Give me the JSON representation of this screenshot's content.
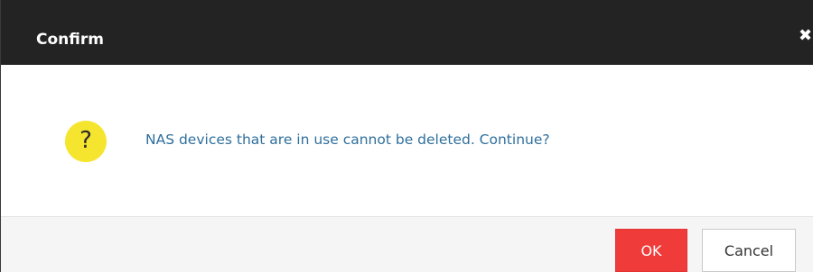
{
  "dialog": {
    "title": "Confirm",
    "close_icon": "close-icon",
    "message_icon": "question-icon",
    "message_icon_glyph": "?",
    "message": "NAS devices that are in use cannot be deleted. Continue?",
    "ok_label": "OK",
    "cancel_label": "Cancel"
  },
  "colors": {
    "titlebar": "#232323",
    "ok_button": "#f03b3b",
    "message_text": "#2f6f9c",
    "question_icon": "#f6e52f"
  }
}
